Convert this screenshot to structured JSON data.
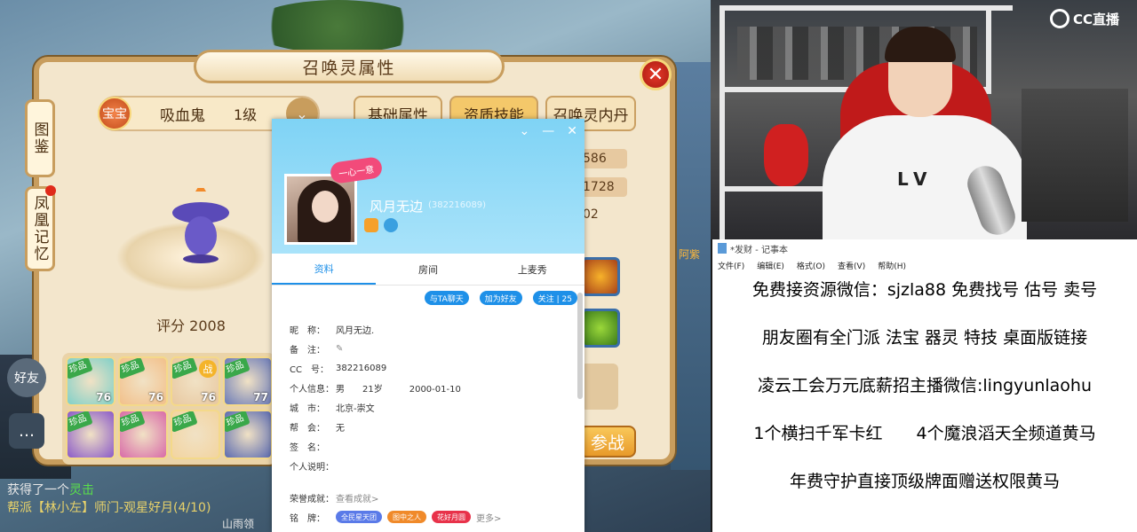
{
  "game": {
    "panel_title": "召唤灵属性",
    "close_label": "✕",
    "side_tabs": [
      "图鉴",
      "凤凰记忆"
    ],
    "pet": {
      "badge": "宝宝",
      "name": "吸血鬼",
      "level": "1级",
      "score": "评分 2008"
    },
    "tabs": [
      "基础属性",
      "资质技能",
      "召唤灵内丹"
    ],
    "stats": [
      "586",
      "1728",
      "02"
    ],
    "join_button": "参战",
    "pet_cards": [
      {
        "tag": "珍品",
        "level": "76",
        "color": "#7fd0c8",
        "badge": ""
      },
      {
        "tag": "珍品",
        "level": "76",
        "color": "#f2c08a",
        "badge": ""
      },
      {
        "tag": "珍品",
        "level": "76",
        "color": "#e8c8a0",
        "badge": "战"
      },
      {
        "tag": "珍品",
        "level": "77",
        "color": "#6a7ab8",
        "badge": ""
      },
      {
        "tag": "珍品",
        "level": "",
        "color": "#8a5ac8",
        "badge": ""
      },
      {
        "tag": "珍品",
        "level": "",
        "color": "#d86aa8",
        "badge": ""
      },
      {
        "tag": "珍品",
        "level": "",
        "color": "#f2d4a0",
        "badge": ""
      },
      {
        "tag": "珍品",
        "level": "",
        "color": "#5a6ab0",
        "badge": ""
      }
    ],
    "chat": {
      "line1_prefix": "获得了一个",
      "line1_item": "灵击",
      "line2": "帮派【林小左】师门-观星好月(4/10)",
      "line3": "山雨领"
    },
    "left_hud": "好友",
    "right_npc": "阿紫"
  },
  "cc_profile": {
    "controls": [
      "⌄",
      "—",
      "✕"
    ],
    "heart_badge": "一心一意",
    "name": "风月无边",
    "id_text": "(382216089)",
    "tabs": [
      "资料",
      "房间",
      "上麦秀"
    ],
    "actions": [
      "与TA聊天",
      "加为好友",
      "关注 | 25"
    ],
    "rows": [
      {
        "k": "昵　称：",
        "v": "风月无边."
      },
      {
        "k": "备　注：",
        "v": "✎"
      },
      {
        "k": "CC　号：",
        "v": "382216089"
      },
      {
        "k": "个人信息：",
        "v": "男　　21岁　　　2000-01-10"
      },
      {
        "k": "城　市：",
        "v": "北京-崇文"
      },
      {
        "k": "帮　会：",
        "v": "无"
      },
      {
        "k": "签　名：",
        "v": ""
      },
      {
        "k": "个人说明：",
        "v": ""
      }
    ],
    "honor_label": "荣誉成就：",
    "honor_value": "查看成就>",
    "medal_label": "铭　牌：",
    "medals": [
      "全民星天团",
      "图中之人",
      "花好月圆"
    ],
    "medal_more": "更多>"
  },
  "cam": {
    "logo": "CC直播",
    "shirt_logo": "LV"
  },
  "notepad": {
    "title": "*发财 - 记事本",
    "menu": [
      "文件(F)",
      "编辑(E)",
      "格式(O)",
      "查看(V)",
      "帮助(H)"
    ],
    "lines": [
      "免费接资源微信：sjzla88 免费找号 估号 卖号",
      "朋友圈有全门派 法宝 器灵 特技  桌面版链接",
      "凌云工会万元底薪招主播微信:lingyunlaohu",
      "1个横扫千军卡红　　4个魔浪滔天全频道黄马",
      "年费守护直接顶级牌面赠送权限黄马"
    ]
  }
}
